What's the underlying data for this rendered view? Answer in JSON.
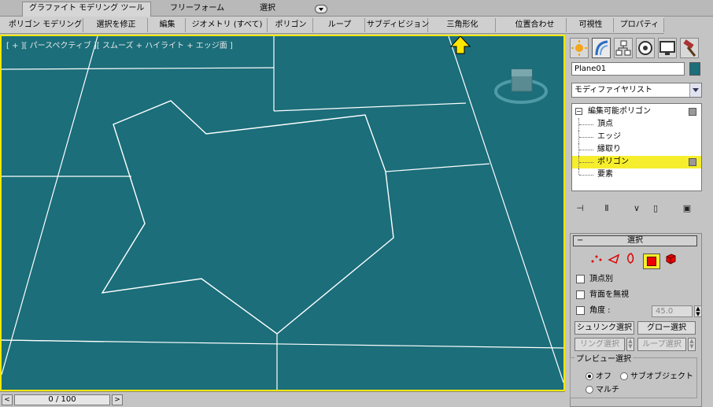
{
  "ribbon": {
    "tabs": [
      "グラファイト モデリング ツール",
      "フリーフォーム",
      "選択"
    ],
    "buttons": [
      "ポリゴン モデリング",
      "選択を修正",
      "編集",
      "ジオメトリ (すべて)",
      "ポリゴン",
      "ループ",
      "サブディビジョン",
      "三角形化",
      "位置合わせ",
      "可視性",
      "プロパティ"
    ]
  },
  "viewport": {
    "label": "[ + ][ パースペクティブ ][ スムーズ + ハイライト + エッジ面 ]",
    "background": "#1b6e7a",
    "border": "#f0e800"
  },
  "annotation": {
    "color": "#ffe600",
    "icon": "yellow-arrow-up"
  },
  "timeline": {
    "frame": "0 / 100",
    "prev": "<",
    "next": ">"
  },
  "command_panel": {
    "object_name": "Plane01",
    "object_color": "#1b6e7a",
    "modifier_list": "モディファイヤリスト",
    "stack": {
      "root": "編集可能ポリゴン",
      "items": [
        "頂点",
        "エッジ",
        "縁取り",
        "ポリゴン",
        "要素"
      ],
      "selected": "ポリゴン"
    },
    "selection": {
      "title": "選択",
      "by_vertex": "頂点別",
      "ignore_backfacing": "背面を無視",
      "angle_label": "角度 :",
      "angle_value": "45.0",
      "shrink": "シュリンク選択",
      "grow": "グロー選択",
      "ring": "リング選択",
      "loop": "ループ選択",
      "preview_title": "プレビュー選択",
      "preview_off": "オフ",
      "preview_subobject": "サブオブジェクト",
      "preview_multi": "マルチ"
    }
  }
}
